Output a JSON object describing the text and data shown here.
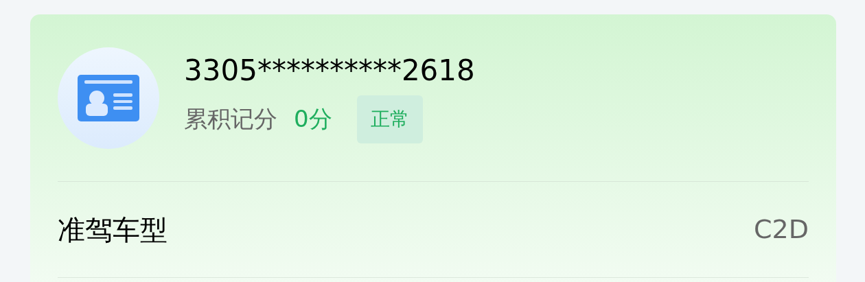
{
  "license": {
    "number": "3305**********2618",
    "points_label": "累积记分",
    "points": "0分",
    "status": {
      "text": "正常",
      "kind": "normal"
    }
  },
  "rows": [
    {
      "label": "准驾车型",
      "value": "C2D"
    }
  ]
}
